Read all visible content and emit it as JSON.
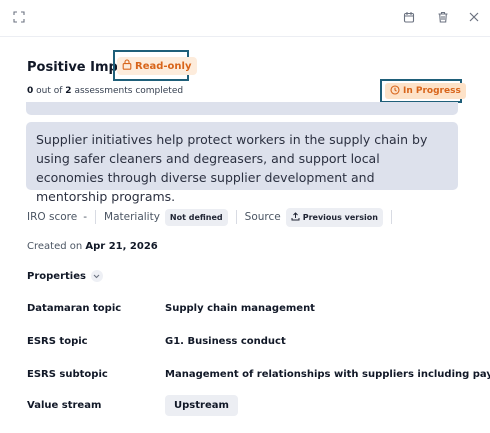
{
  "toolbar": {
    "icons": [
      "expand-icon",
      "calendar-icon",
      "trash-icon",
      "close-icon"
    ]
  },
  "header": {
    "title": "Positive Impact",
    "badge": "Read-only",
    "progress_count": "0",
    "progress_mid": "out of",
    "progress_total": "2",
    "progress_suffix": "assessments completed",
    "status": "In Progress"
  },
  "description": "Supplier initiatives help protect workers in the supply chain by using safer cleaners and degreasers, and support local economies through diverse supplier development and mentorship programs.",
  "meta": {
    "iro_label": "IRO score",
    "iro_value": "-",
    "materiality_label": "Materiality",
    "materiality_value": "Not defined",
    "source_label": "Source",
    "source_value": "Previous version"
  },
  "created": {
    "label": "Created on",
    "date": "Apr 21, 2026"
  },
  "properties": {
    "header": "Properties",
    "rows": [
      {
        "label": "Datamaran topic",
        "value": "Supply chain management"
      },
      {
        "label": "ESRS topic",
        "value": "G1. Business conduct"
      },
      {
        "label": "ESRS subtopic",
        "value": "Management of relationships with suppliers including payment pract"
      },
      {
        "label": "Value stream",
        "value": "Upstream"
      }
    ]
  },
  "colors": {
    "accent_orange": "#d8651b",
    "badge_bg": "#fdecdc",
    "highlight_frame": "#1f5f79",
    "description_bg": "#dde1ec"
  }
}
